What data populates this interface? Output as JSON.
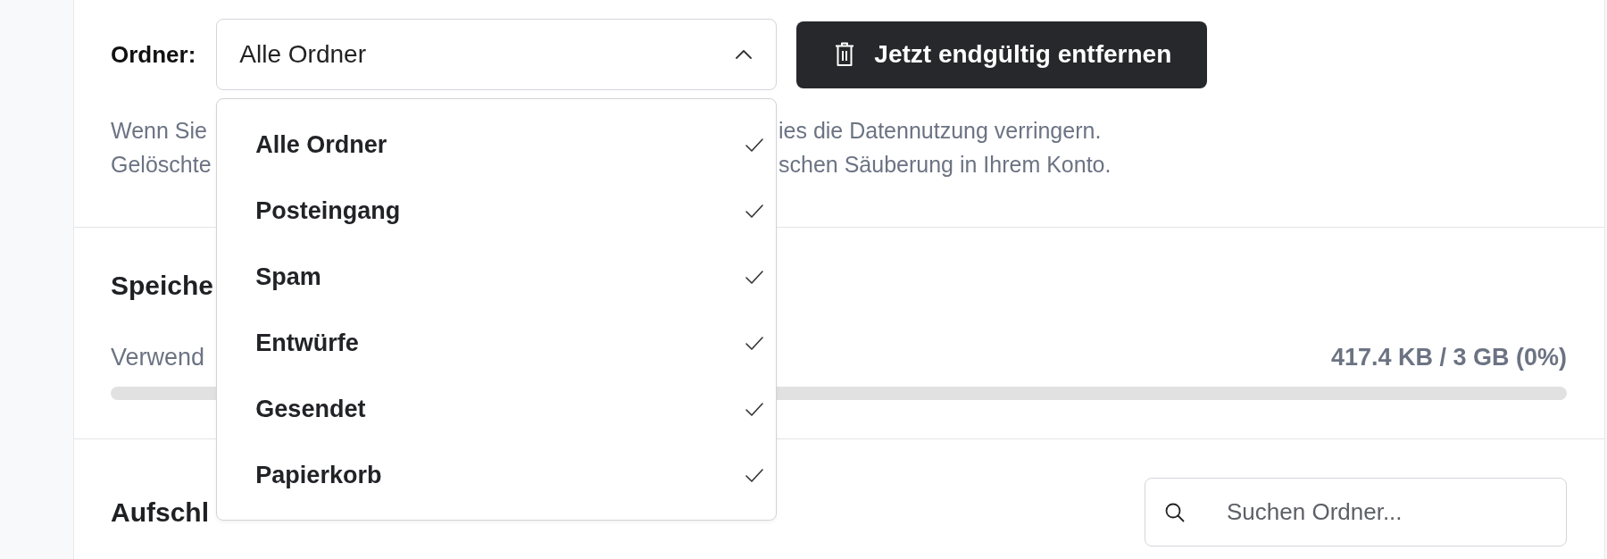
{
  "filter": {
    "label": "Ordner:",
    "select": {
      "value": "Alle Ordner",
      "expanded": true,
      "options": [
        {
          "label": "Alle Ordner",
          "checked": true
        },
        {
          "label": "Posteingang",
          "checked": true
        },
        {
          "label": "Spam",
          "checked": true
        },
        {
          "label": "Entwürfe",
          "checked": true
        },
        {
          "label": "Gesendet",
          "checked": true
        },
        {
          "label": "Papierkorb",
          "checked": true
        }
      ]
    },
    "delete_button": {
      "label": "Jetzt endgültig entfernen"
    }
  },
  "description": {
    "lines": [
      {
        "left": "Wenn Sie",
        "right": "ies die Datennutzung verringern."
      },
      {
        "left": "Gelöschte",
        "right": "schen Säuberung in Ihrem Konto."
      }
    ]
  },
  "storage": {
    "heading": "Speiche",
    "label": "Verwend",
    "usage": "417.4 KB / 3 GB (0%)"
  },
  "breakdown": {
    "heading": "Aufschl",
    "search": {
      "placeholder": "Suchen Ordner..."
    }
  }
}
